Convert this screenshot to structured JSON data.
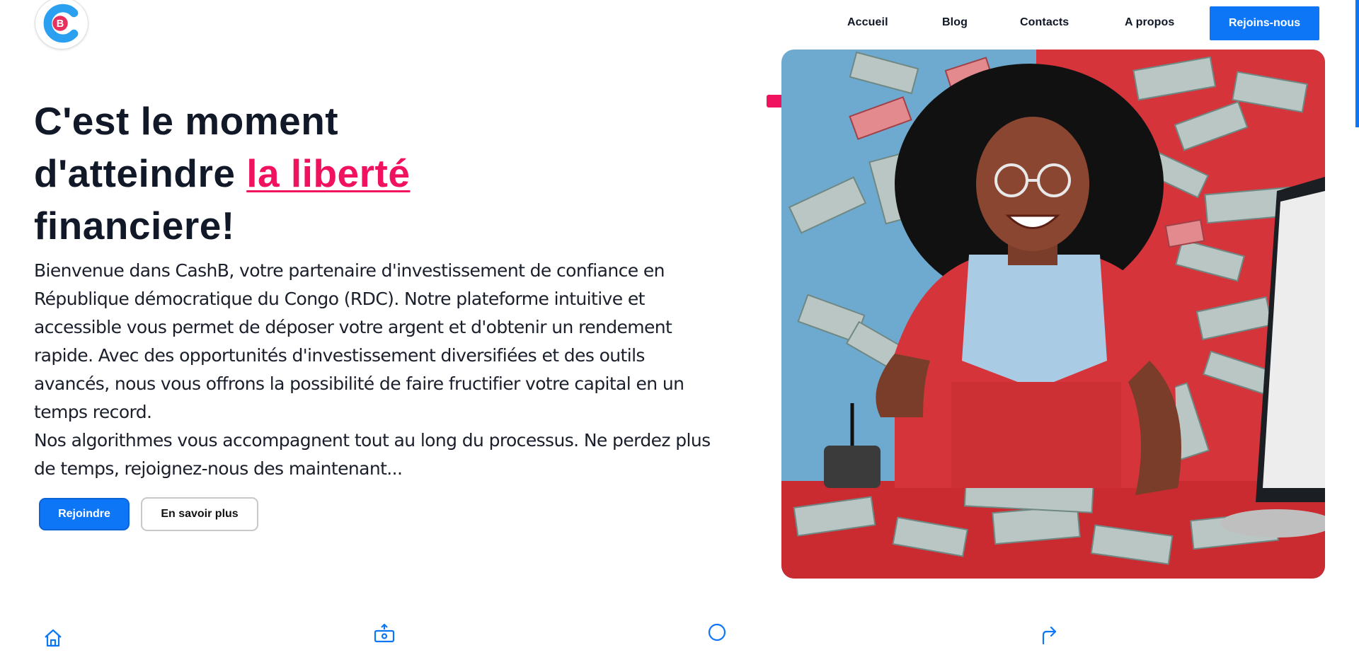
{
  "brand": {
    "logo_letter": "B",
    "colors": {
      "primary": "#0d76f7",
      "accent": "#f0115f",
      "text": "#111827"
    }
  },
  "nav": {
    "items": [
      {
        "label": "Accueil"
      },
      {
        "label": "Blog"
      },
      {
        "label": "Contacts"
      },
      {
        "label": "A propos"
      }
    ],
    "cta_label": "Rejoins-nous"
  },
  "hero": {
    "headline_line1": "C'est le moment",
    "headline_line2_start": "d'atteindre ",
    "headline_accent": "la liberté",
    "headline_line3": "financiere!",
    "paragraph1": "Bienvenue dans CashB, votre partenaire d'investissement de confiance en République démocratique du Congo (RDC). Notre plateforme intuitive et accessible vous permet de déposer votre argent et d'obtenir un rendement rapide. Avec des opportunités d'investissement diversifiées et des outils avancés, nous vous offrons la possibilité de faire fructifier votre capital en un temps record.",
    "paragraph2": "Nos algorithmes vous accompagnent tout au long du processus. Ne perdez plus de temps, rejoignez-nous des maintenant...",
    "primary_button": "Rejoindre",
    "secondary_button": "En savoir plus"
  },
  "illustration": {
    "icon": "woman-with-money-illustration"
  },
  "features": {
    "icons": [
      "home-icon",
      "money-transfer-icon",
      "circle-icon",
      "arrow-turn-up-right-icon"
    ]
  }
}
